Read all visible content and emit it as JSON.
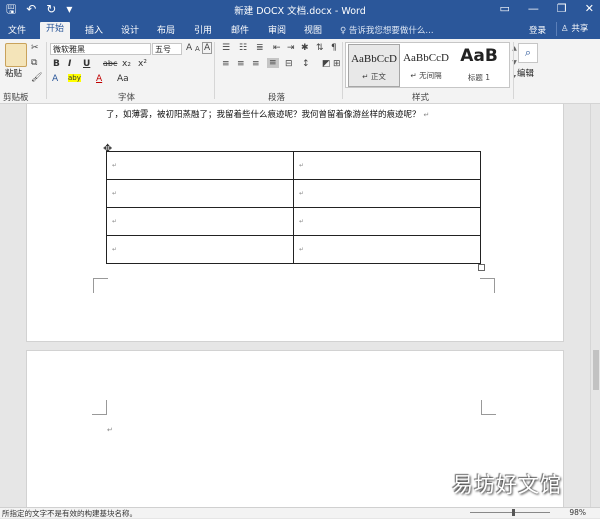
{
  "titlebar": {
    "title": "新建 DOCX 文档.docx - Word",
    "qat": {
      "save": "🖫",
      "undo": "↶",
      "redo": "↻",
      "more": "▾"
    },
    "controls": {
      "ribbon_options": "▭",
      "minimize": "—",
      "maximize": "❐",
      "close": "✕"
    }
  },
  "tabs": [
    {
      "label": "文件"
    },
    {
      "label": "开始"
    },
    {
      "label": "插入"
    },
    {
      "label": "设计"
    },
    {
      "label": "布局"
    },
    {
      "label": "引用"
    },
    {
      "label": "邮件"
    },
    {
      "label": "审阅"
    },
    {
      "label": "视图"
    }
  ],
  "tellme": "♀ 告诉我您想要做什么...",
  "login": "登录",
  "share": "♙ 共享",
  "clipboard": {
    "paste": "粘贴",
    "group": "剪贴板"
  },
  "font": {
    "name": "微软雅黑",
    "size": "五号",
    "group": "字体",
    "btn_bold": "B",
    "btn_italic": "I",
    "btn_underline": "U",
    "btn_strike": "abc",
    "btn_sub": "x₂",
    "btn_sup": "x²",
    "btn_color": "A",
    "btn_highlight": "aby",
    "btn_grow": "A",
    "btn_shrink": "A",
    "btn_aa": "Aa",
    "btn_clear": "A"
  },
  "paragraph": {
    "group": "段落"
  },
  "styles": {
    "group": "样式",
    "items": [
      {
        "preview": "AaBbCcD",
        "name": "↵ 正文"
      },
      {
        "preview": "AaBbCcD",
        "name": "↵ 无间隔"
      },
      {
        "preview": "AaB",
        "name": "标题 1"
      }
    ]
  },
  "editing": {
    "label": "编辑",
    "icon": "⌕"
  },
  "document": {
    "paragraph_text": "了，如薄雾，被初阳蒸融了；我留着些什么痕迹呢？我何曾留着像游丝样的痕迹呢？",
    "pilcrow": "↵",
    "table": {
      "rows": [
        [
          "↵",
          "↵"
        ],
        [
          "↵",
          "↵"
        ],
        [
          "↵",
          "↵"
        ],
        [
          "↵",
          "↵"
        ]
      ]
    }
  },
  "watermark": "易坊好文馆",
  "statusbar": {
    "message": "所指定的文字不是有效的构建基块名称。",
    "zoom": "98%"
  }
}
